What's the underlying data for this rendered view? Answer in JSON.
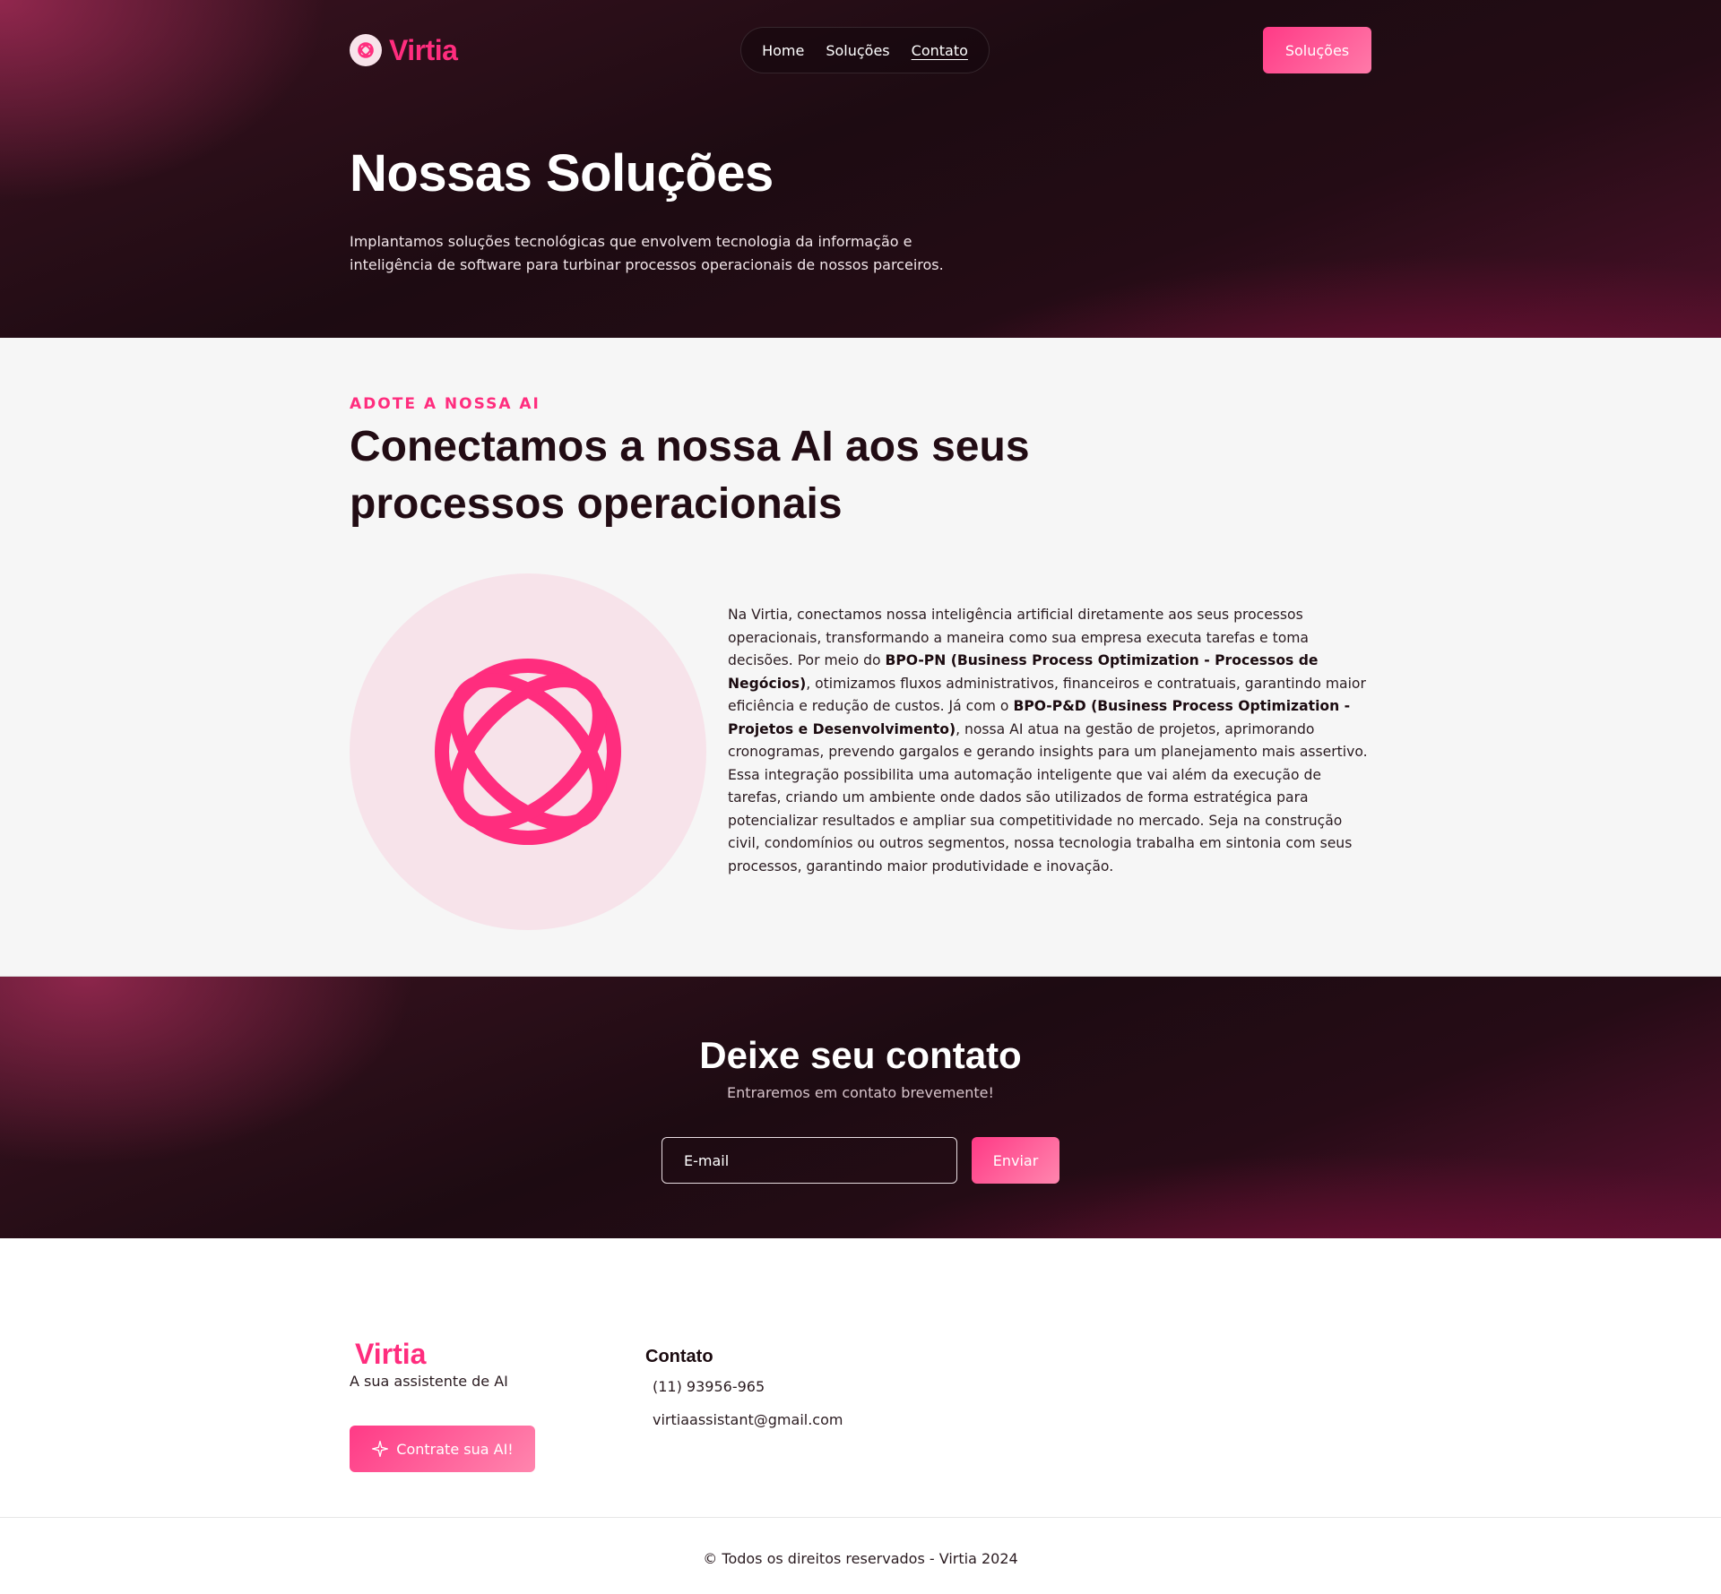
{
  "brand": {
    "name": "Virtia",
    "accent": "#ff2d7e"
  },
  "nav": {
    "links": [
      "Home",
      "Soluções",
      "Contato"
    ],
    "cta": "Soluções"
  },
  "hero": {
    "title": "Nossas Soluções",
    "subtitle": "Implantamos soluções tecnológicas que envolvem tecnologia da informação e inteligência de software para turbinar processos operacionais de nossos parceiros."
  },
  "solutions": {
    "eyebrow": "ADOTE A NOSSA AI",
    "title": "Conectamos a nossa AI aos seus processos operacionais",
    "p1": "Na Virtia, conectamos nossa inteligência artificial diretamente aos seus processos operacionais, transformando a maneira como sua empresa executa tarefas e toma decisões. Por meio do ",
    "bold1": "BPO-PN (Business Process Optimization - Processos de Negócios)",
    "p2": ", otimizamos fluxos administrativos, financeiros e contratuais, garantindo maior eficiência e redução de custos. Já com o ",
    "bold2": "BPO-P&D (Business Process Optimization - Projetos e Desenvolvimento)",
    "p3": ", nossa AI atua na gestão de projetos, aprimorando cronogramas, prevendo gargalos e gerando insights para um planejamento mais assertivo. Essa integração possibilita uma automação inteligente que vai além da execução de tarefas, criando um ambiente onde dados são utilizados de forma estratégica para potencializar resultados e ampliar sua competitividade no mercado. Seja na construção civil, condomínios ou outros segmentos, nossa tecnologia trabalha em sintonia com seus processos, garantindo maior produtividade e inovação."
  },
  "contact": {
    "title": "Deixe seu contato",
    "subtitle": "Entraremos em contato brevemente!",
    "email_placeholder": "E-mail",
    "submit": "Enviar"
  },
  "footer": {
    "brand": "Virtia",
    "tagline": "A sua assistente de AI",
    "cta": "Contrate sua AI!",
    "contact_heading": "Contato",
    "phone": "(11) 93956-965",
    "email": "virtiaassistant@gmail.com",
    "copyright": "© Todos os direitos reservados - Virtia 2024"
  }
}
